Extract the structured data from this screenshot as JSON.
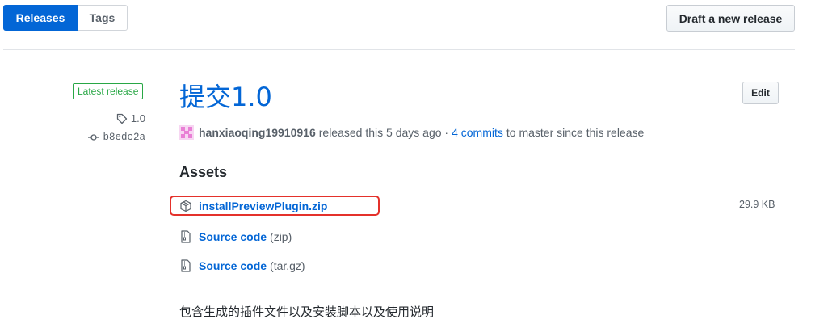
{
  "tabs": [
    {
      "label": "Releases",
      "selected": true
    },
    {
      "label": "Tags",
      "selected": false
    }
  ],
  "toolbar": {
    "draft_label": "Draft a new release"
  },
  "sidebar": {
    "badge": "Latest release",
    "tag": "1.0",
    "commit": "b8edc2a",
    "icons": {
      "tag": "tag-icon",
      "commit": "git-commit-icon"
    }
  },
  "release": {
    "title": "提交1.0",
    "edit_label": "Edit",
    "author": "hanxiaoqing19910916",
    "released_text": "released this 5 days ago ·",
    "commits_link": "4 commits",
    "commits_suffix": "to master since this release",
    "description": "包含生成的插件文件以及安装脚本以及使用说明"
  },
  "assets": {
    "heading": "Assets",
    "items": [
      {
        "name": "installPreviewPlugin.zip",
        "ext": "",
        "size": "29.9 KB",
        "icon": "package-icon"
      },
      {
        "name": "Source code",
        "ext": "(zip)",
        "size": "",
        "icon": "file-zip-icon"
      },
      {
        "name": "Source code",
        "ext": "(tar.gz)",
        "size": "",
        "icon": "file-zip-icon"
      }
    ]
  },
  "colors": {
    "accent": "#0366d6",
    "success": "#28a745",
    "highlight": "#e4312b",
    "avatar": "#e97fd5"
  }
}
